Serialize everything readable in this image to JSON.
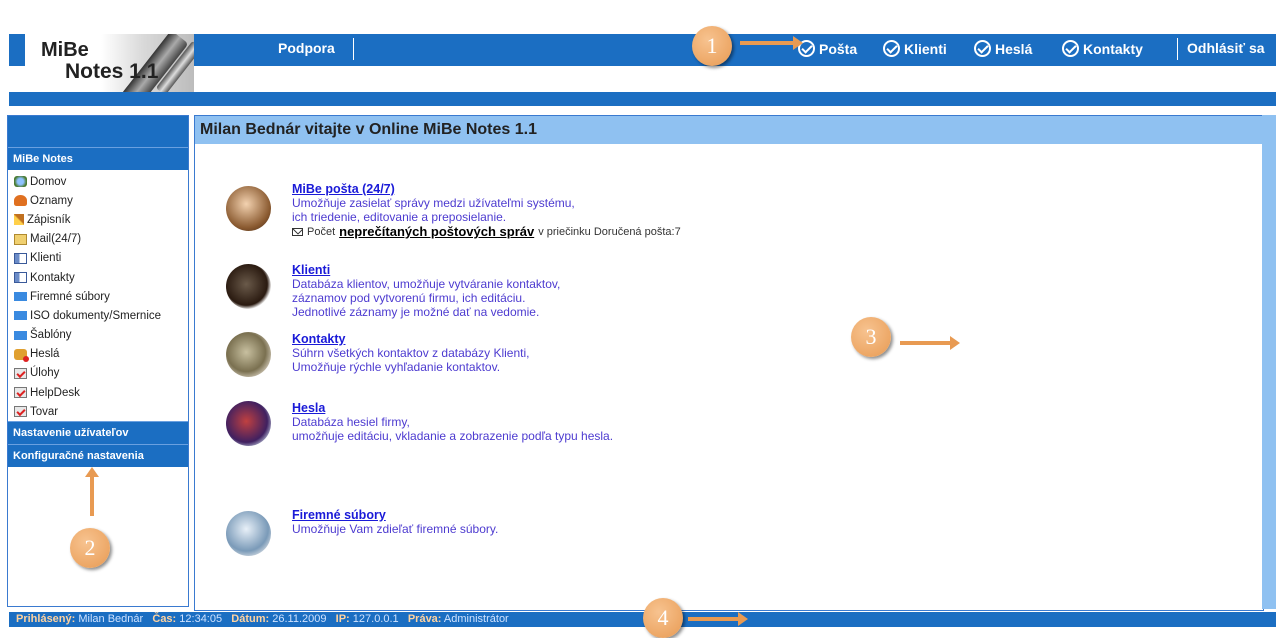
{
  "logo": {
    "line1": "MiBe",
    "line2": "Notes 1.1"
  },
  "header": {
    "support_link": "Podpora",
    "nav": [
      "Pošta",
      "Klienti",
      "Heslá",
      "Kontakty"
    ],
    "logout": "Odhlásiť sa"
  },
  "sidebar": {
    "section_main": "MiBe Notes",
    "items": [
      {
        "label": "Domov",
        "icon": "home-icon"
      },
      {
        "label": "Oznamy",
        "icon": "bell-icon"
      },
      {
        "label": "Zápisník",
        "icon": "pencil-icon"
      },
      {
        "label": "Mail(24/7)",
        "icon": "mail-icon"
      },
      {
        "label": "Klienti",
        "icon": "card-icon"
      },
      {
        "label": "Kontakty",
        "icon": "card-icon"
      },
      {
        "label": "Firemné súbory",
        "icon": "folder-icon"
      },
      {
        "label": "ISO dokumenty/Smernice",
        "icon": "folder-icon"
      },
      {
        "label": "Šablóny",
        "icon": "folder-icon"
      },
      {
        "label": "Heslá",
        "icon": "key-icon"
      },
      {
        "label": "Úlohy",
        "icon": "task-icon"
      },
      {
        "label": "HelpDesk",
        "icon": "task-icon"
      },
      {
        "label": "Tovar",
        "icon": "task-icon"
      }
    ],
    "section_users": "Nastavenie užívateľov",
    "section_config": "Konfiguračné nastavenia"
  },
  "main": {
    "title": "Milan Bednár vitajte v Online MiBe Notes 1.1",
    "entries": {
      "mail": {
        "title": "MiBe pošta (24/7)",
        "lines": [
          "Umožňuje zasielať správy medzi užívateľmi systému,",
          "ich triedenie, editovanie a preposielanie."
        ],
        "count_prefix": "Počet",
        "count_link": "neprečítaných poštových správ",
        "count_suffix": "v priečinku Doručená pošta:7"
      },
      "clients": {
        "title": "Klienti",
        "lines": [
          "Databáza klientov, umožňuje vytváranie kontaktov,",
          "záznamov pod vytvorenú firmu, ich editáciu.",
          "Jednotlivé záznamy je možné dať na vedomie."
        ]
      },
      "contacts": {
        "title": "Kontakty",
        "lines": [
          "Súhrn všetkých kontaktov z databázy Klienti,",
          "Umožňuje rýchle vyhľadanie kontaktov."
        ]
      },
      "passwords": {
        "title": "Hesla",
        "lines": [
          "Databáza hesiel firmy,",
          "umožňuje editáciu, vkladanie a zobrazenie podľa typu hesla."
        ]
      },
      "files": {
        "title": "Firemné súbory",
        "lines": [
          "Umožňuje Vam zdieľať firemné súbory."
        ]
      }
    }
  },
  "footer": {
    "user_label": "Prihlásený:",
    "user_value": "Milan Bednár",
    "time_label": "Čas:",
    "time_value": "12:34:05",
    "date_label": "Dátum:",
    "date_value": "26.11.2009",
    "ip_label": "IP:",
    "ip_value": "127.0.0.1",
    "rights_label": "Práva:",
    "rights_value": "Administrátor"
  },
  "callouts": [
    "1",
    "2",
    "3",
    "4"
  ],
  "colors": {
    "header_blue": "#1b6ec2",
    "title_bar": "#8fc1f1",
    "link": "#1a1ad8",
    "desc_text": "#4d3bd0",
    "callout": "#e89a52"
  }
}
